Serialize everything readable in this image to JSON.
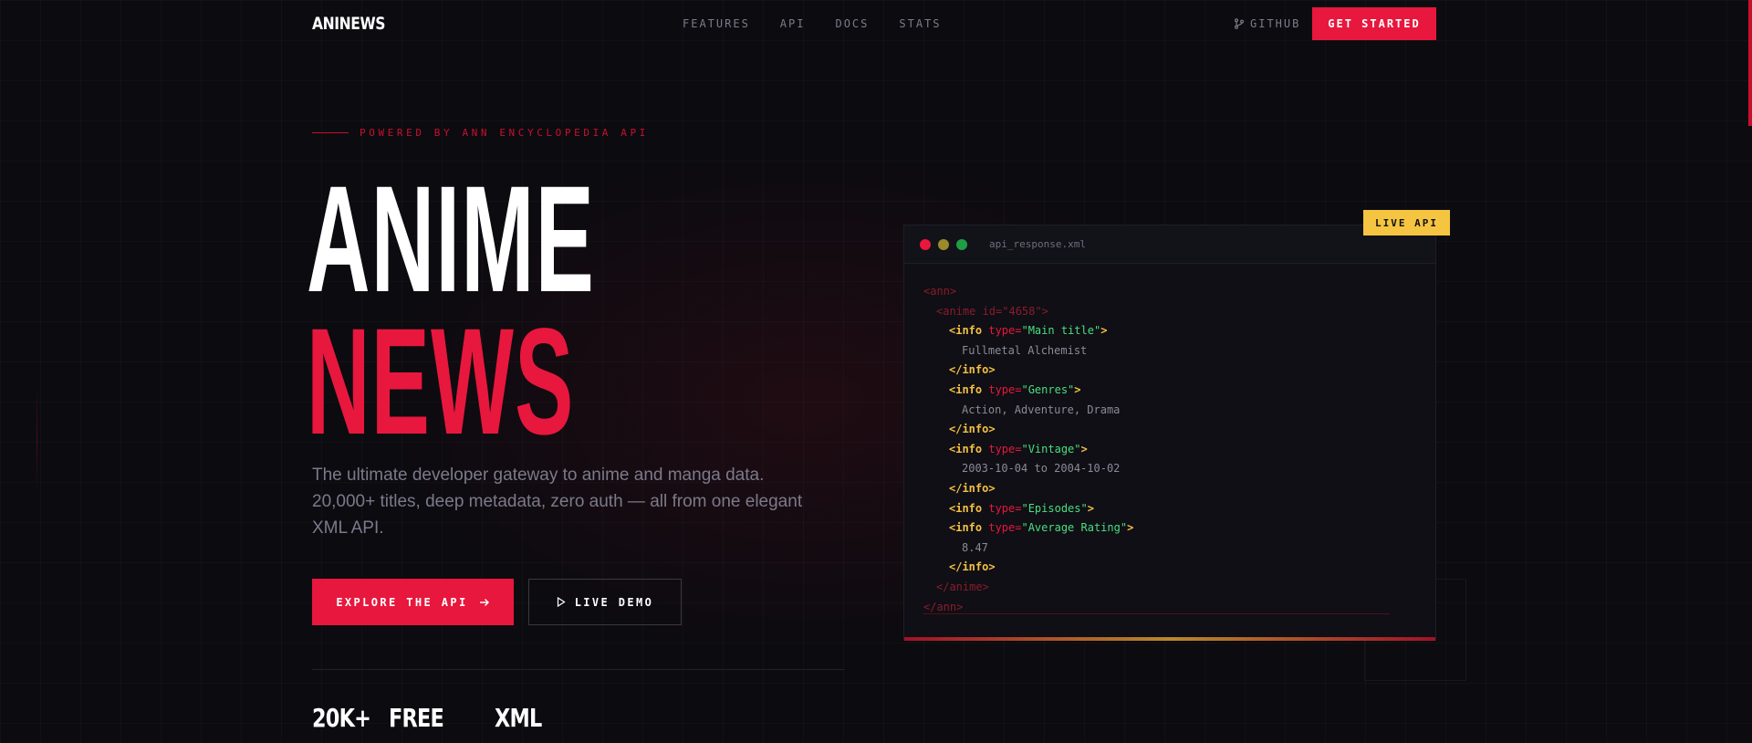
{
  "nav": {
    "logo": "ANINEWS",
    "links": [
      "FEATURES",
      "API",
      "DOCS",
      "STATS"
    ],
    "github_label": "GITHUB",
    "cta_label": "GET STARTED"
  },
  "hero": {
    "eyebrow": "POWERED BY ANN ENCYCLOPEDIA API",
    "title_line1": "ANIME",
    "title_line2": "NEWS",
    "description": [
      "The ultimate developer gateway to anime and manga data.",
      "20,000+ titles, deep metadata, zero auth — all from one elegant",
      "XML API."
    ],
    "primary_button": "EXPLORE THE API",
    "secondary_button": "LIVE DEMO"
  },
  "stats": [
    "20K+",
    "FREE",
    "XML"
  ],
  "panel": {
    "filename": "api_response.xml",
    "badge": "LIVE API",
    "dot_colors": [
      "#e8173d",
      "#9c8a2a",
      "#1f9d46"
    ],
    "lines": [
      {
        "indent": 0,
        "kind": "dim",
        "text": "<ann>"
      },
      {
        "indent": 1,
        "kind": "dim",
        "text": "<anime id=\"4658\">"
      },
      {
        "indent": 2,
        "kind": "open",
        "tag": "<info ",
        "attr": "type=",
        "value": "\"Main title\"",
        "close": ">"
      },
      {
        "indent": 3,
        "kind": "text",
        "text": "Fullmetal Alchemist"
      },
      {
        "indent": 2,
        "kind": "tag",
        "text": "</info>"
      },
      {
        "indent": 2,
        "kind": "open",
        "tag": "<info ",
        "attr": "type=",
        "value": "\"Genres\"",
        "close": ">"
      },
      {
        "indent": 3,
        "kind": "text",
        "text": "Action, Adventure, Drama"
      },
      {
        "indent": 2,
        "kind": "tag",
        "text": "</info>"
      },
      {
        "indent": 2,
        "kind": "open",
        "tag": "<info ",
        "attr": "type=",
        "value": "\"Vintage\"",
        "close": ">"
      },
      {
        "indent": 3,
        "kind": "text",
        "text": "2003-10-04 to 2004-10-02"
      },
      {
        "indent": 2,
        "kind": "tag",
        "text": "</info>"
      },
      {
        "indent": 2,
        "kind": "open",
        "tag": "<info ",
        "attr": "type=",
        "value": "\"Episodes\"",
        "close": ">"
      },
      {
        "indent": 2,
        "kind": "open",
        "tag": "<info ",
        "attr": "type=",
        "value": "\"Average Rating\"",
        "close": ">"
      },
      {
        "indent": 3,
        "kind": "text",
        "text": "8.47"
      },
      {
        "indent": 2,
        "kind": "tag",
        "text": "</info>"
      },
      {
        "indent": 1,
        "kind": "dim",
        "text": "</anime>"
      },
      {
        "indent": 0,
        "kind": "dim",
        "text": "</ann>"
      }
    ]
  },
  "colors": {
    "accent": "#e8173d",
    "badge": "#f5c542",
    "background": "#0c0b10"
  }
}
